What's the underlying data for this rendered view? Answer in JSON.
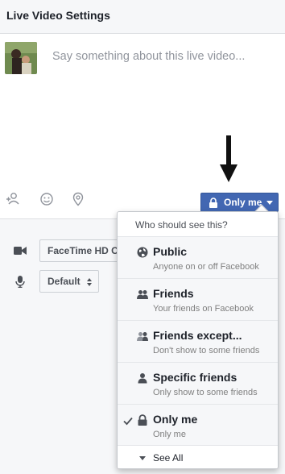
{
  "header": {
    "title": "Live Video Settings"
  },
  "composer": {
    "placeholder": "Say something about this live video...",
    "tools": [
      "tag-friends-icon",
      "feeling-icon",
      "location-pin-icon"
    ]
  },
  "privacy_button": {
    "label": "Only me",
    "icon": "lock-icon",
    "color": "#4267b2"
  },
  "settings": {
    "camera": {
      "icon": "video-camera-icon",
      "value": "FaceTime HD C"
    },
    "microphone": {
      "icon": "microphone-icon",
      "value": "Default"
    }
  },
  "dropdown": {
    "header": "Who should see this?",
    "items": [
      {
        "icon": "globe-icon",
        "label": "Public",
        "desc": "Anyone on or off Facebook",
        "selected": false
      },
      {
        "icon": "friends-icon",
        "label": "Friends",
        "desc": "Your friends on Facebook",
        "selected": false
      },
      {
        "icon": "friends-except-icon",
        "label": "Friends except...",
        "desc": "Don't show to some friends",
        "selected": false
      },
      {
        "icon": "specific-friend-icon",
        "label": "Specific friends",
        "desc": "Only show to some friends",
        "selected": false
      },
      {
        "icon": "lock-icon",
        "label": "Only me",
        "desc": "Only me",
        "selected": true
      }
    ],
    "see_all": "See All"
  }
}
